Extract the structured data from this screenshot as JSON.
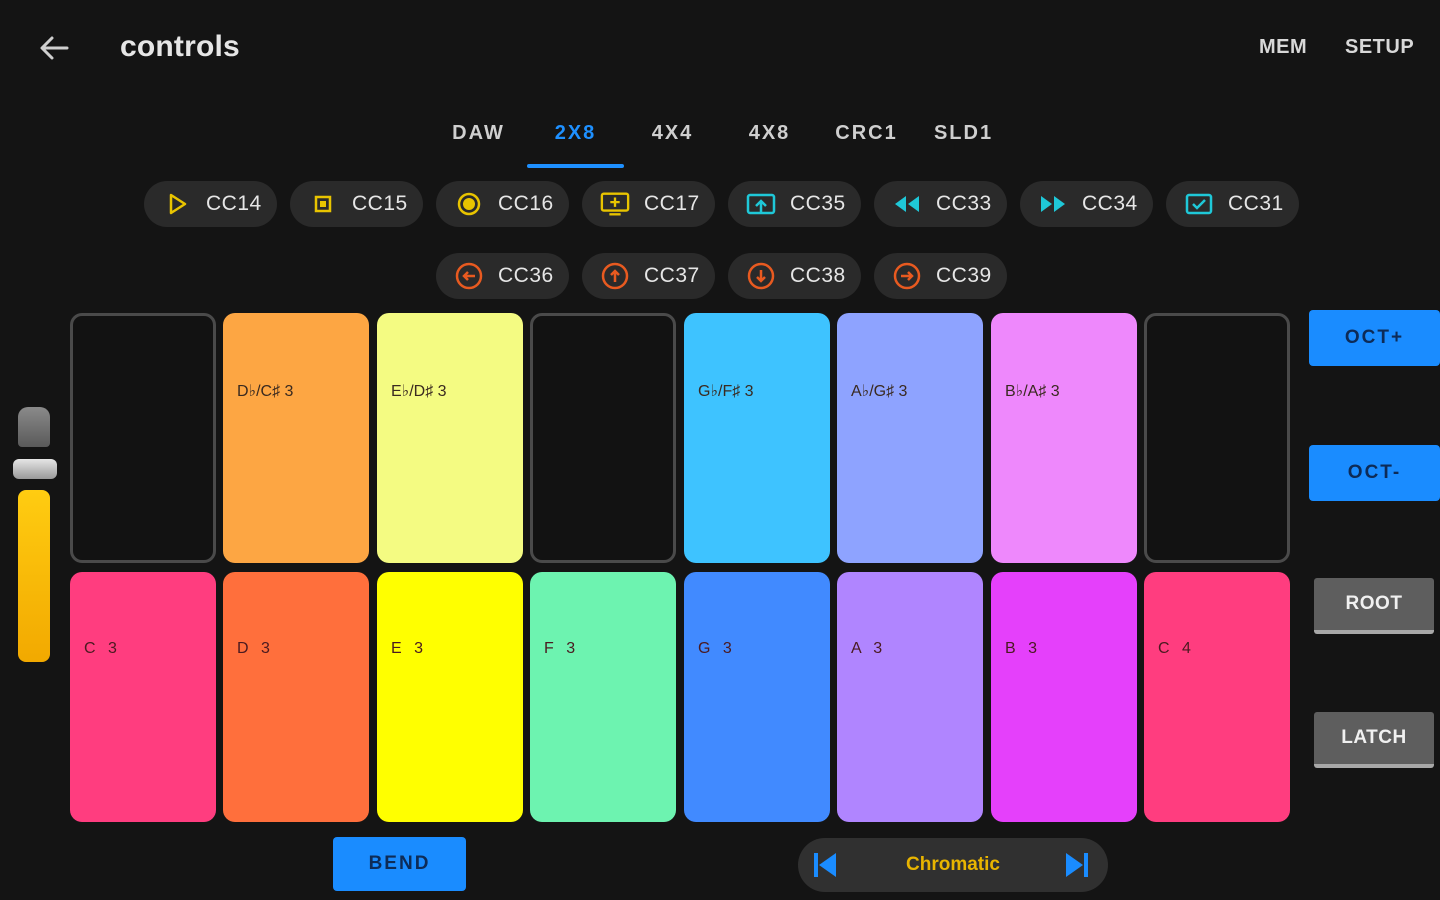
{
  "header": {
    "title": "controls",
    "mem_label": "MEM",
    "setup_label": "SETUP"
  },
  "tabs": [
    {
      "label": "DAW",
      "active": false
    },
    {
      "label": "2X8",
      "active": true
    },
    {
      "label": "4X4",
      "active": false
    },
    {
      "label": "4X8",
      "active": false
    },
    {
      "label": "CRC1",
      "active": false
    },
    {
      "label": "SLD1",
      "active": false
    }
  ],
  "chips_row1": [
    {
      "label": "CC14",
      "icon": "play-icon",
      "color": "#e8c400"
    },
    {
      "label": "CC15",
      "icon": "stop-icon",
      "color": "#e8c400"
    },
    {
      "label": "CC16",
      "icon": "record-icon",
      "color": "#e8c400"
    },
    {
      "label": "CC17",
      "icon": "add-marker-icon",
      "color": "#e8c400"
    },
    {
      "label": "CC35",
      "icon": "loop-icon",
      "color": "#1fc8d8"
    },
    {
      "label": "CC33",
      "icon": "rewind-icon",
      "color": "#1fc8d8"
    },
    {
      "label": "CC34",
      "icon": "fast-forward-icon",
      "color": "#1fc8d8"
    },
    {
      "label": "CC31",
      "icon": "checkbox-icon",
      "color": "#1fc8d8"
    }
  ],
  "chips_row2": [
    {
      "label": "CC36",
      "icon": "arrow-left-circle-icon",
      "color": "#e85a20"
    },
    {
      "label": "CC37",
      "icon": "arrow-up-circle-icon",
      "color": "#e85a20"
    },
    {
      "label": "CC38",
      "icon": "arrow-down-circle-icon",
      "color": "#e85a20"
    },
    {
      "label": "CC39",
      "icon": "arrow-right-circle-icon",
      "color": "#e85a20"
    }
  ],
  "pads_top": [
    {
      "label": "",
      "color": ""
    },
    {
      "label": "D♭/C♯ 3",
      "color": "#fda643"
    },
    {
      "label": "E♭/D♯ 3",
      "color": "#f4fb82"
    },
    {
      "label": "",
      "color": ""
    },
    {
      "label": "G♭/F♯ 3",
      "color": "#3ec3ff"
    },
    {
      "label": "A♭/G♯ 3",
      "color": "#8ea3ff"
    },
    {
      "label": "B♭/A♯ 3",
      "color": "#ee88fc"
    },
    {
      "label": "",
      "color": ""
    }
  ],
  "pads_bottom": [
    {
      "label": "C 3",
      "color": "#ff3d7f"
    },
    {
      "label": "D 3",
      "color": "#ff6f3c"
    },
    {
      "label": "E 3",
      "color": "#ffff00"
    },
    {
      "label": "F 3",
      "color": "#6df3b0"
    },
    {
      "label": "G 3",
      "color": "#418aff"
    },
    {
      "label": "A 3",
      "color": "#b085ff"
    },
    {
      "label": "B 3",
      "color": "#e540fb"
    },
    {
      "label": "C 4",
      "color": "#ff3d7f"
    }
  ],
  "side": {
    "oct_plus": "OCT+",
    "oct_minus": "OCT-",
    "root": "ROOT",
    "latch": "LATCH"
  },
  "bottom": {
    "bend": "BEND",
    "scale": "Chromatic"
  },
  "colors": {
    "accent": "#1a8cff",
    "scale_text": "#e8b400",
    "slider_fill": "#ffcc11"
  }
}
